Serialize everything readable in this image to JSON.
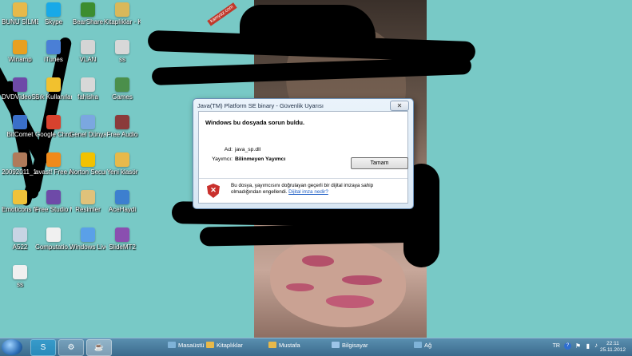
{
  "desktop": {
    "icons": [
      {
        "label": "BUNU SİLME",
        "icon": "folder-icon",
        "color": "#e7b94a"
      },
      {
        "label": "Skype",
        "icon": "skype-icon",
        "color": "#18a9e8"
      },
      {
        "label": "BearShare",
        "icon": "bearshare-icon",
        "color": "#3c8d2f"
      },
      {
        "label": "Kitaplıklar - Kısayol",
        "icon": "libraries-icon",
        "color": "#d9b85a"
      },
      {
        "label": "Winamp",
        "icon": "winamp-icon",
        "color": "#e8a020"
      },
      {
        "label": "iTunes",
        "icon": "itunes-icon",
        "color": "#4a7fd6"
      },
      {
        "label": "VLAN",
        "icon": "network-icon",
        "color": "#d5d5d5"
      },
      {
        "label": "ss",
        "icon": "printer-icon",
        "color": "#d8d8d8"
      },
      {
        "label": "DVDVideoSoft Free Studio",
        "icon": "freestudio-icon",
        "color": "#6e4aa8"
      },
      {
        "label": "Sık Kullanılanlar",
        "icon": "star-icon",
        "color": "#f2c12e"
      },
      {
        "label": "fahisha",
        "icon": "printer-icon",
        "color": "#d8d8d8"
      },
      {
        "label": "Games",
        "icon": "games-icon",
        "color": "#4b8f4b"
      },
      {
        "label": "BitComet",
        "icon": "bitcomet-icon",
        "color": "#3a6fc9"
      },
      {
        "label": "Google Chrome",
        "icon": "chrome-icon",
        "color": "#d8422e"
      },
      {
        "label": "Genel Dünya",
        "icon": "app-icon",
        "color": "#7ba7e0"
      },
      {
        "label": "Free Audio",
        "icon": "freestudio-icon",
        "color": "#8b3a3a"
      },
      {
        "label": "20092011_1...",
        "icon": "photo-icon",
        "color": "#b07a5a"
      },
      {
        "label": "avast! Free Antivirus",
        "icon": "avast-icon",
        "color": "#f08a1a"
      },
      {
        "label": "Norton Security Scan",
        "icon": "norton-icon",
        "color": "#f2c200"
      },
      {
        "label": "Yeni klasör",
        "icon": "folder-icon",
        "color": "#e7b94a"
      },
      {
        "label": "Emoticons for your ...",
        "icon": "emoticon-icon",
        "color": "#f0c23a"
      },
      {
        "label": "Free Studio Manager",
        "icon": "freestudio-icon",
        "color": "#6e4aa8"
      },
      {
        "label": "Resimler",
        "icon": "pictures-icon",
        "color": "#e0c27a"
      },
      {
        "label": "AceHaydi",
        "icon": "app-icon",
        "color": "#3d7fcf"
      },
      {
        "label": "A522",
        "icon": "app-icon",
        "color": "#c8d4e4"
      },
      {
        "label": "Computatio...",
        "icon": "document-icon",
        "color": "#f0f0f0"
      },
      {
        "label": "Windows Live Mesa...",
        "icon": "messenger-icon",
        "color": "#5aa0e8"
      },
      {
        "label": "SlideMT2",
        "icon": "archive-icon",
        "color": "#8a4fb0"
      },
      {
        "label": "ss",
        "icon": "document-icon",
        "color": "#f0f0f0"
      }
    ],
    "watermark": "kamyaz.com"
  },
  "dialog": {
    "title": "Java(TM) Platform SE binary - Güvenlik Uyarısı",
    "close_label": "✕",
    "heading": "Windows bu dosyada sorun buldu.",
    "name_key": "Ad:",
    "name_value": "java_sp.dll",
    "publisher_key": "Yayımcı:",
    "publisher_value": "Bilinmeyen Yayımcı",
    "ok_label": "Tamam",
    "warning_text": "Bu dosya, yayımcısını doğrulayan geçerli bir dijital imzaya sahip olmadığından engellendi.",
    "link_text": "Dijital imza nedir?"
  },
  "taskbar": {
    "items": [
      {
        "label": "Masaüstü",
        "icon": "desktop-icon"
      },
      {
        "label": "Kitaplıklar",
        "icon": "folder-icon"
      },
      {
        "label": "Mustafa",
        "icon": "folder-icon"
      },
      {
        "label": "Bilgisayar",
        "icon": "computer-icon"
      },
      {
        "label": "Ağ",
        "icon": "network-icon"
      }
    ],
    "language": "TR",
    "time": "22:11",
    "date": "25.11.2012"
  }
}
